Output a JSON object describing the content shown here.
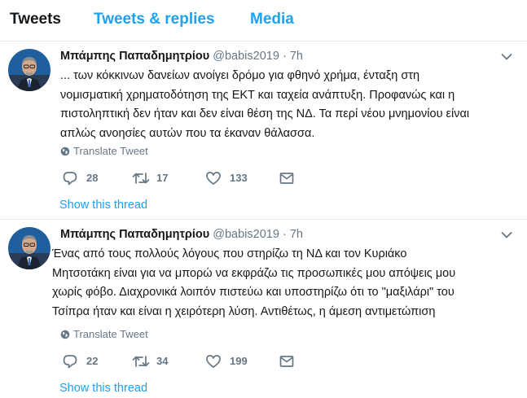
{
  "tabs": [
    {
      "label": "Tweets",
      "active": true
    },
    {
      "label": "Tweets & replies",
      "active": false
    },
    {
      "label": "Media",
      "active": false
    }
  ],
  "colors": {
    "accent": "#1da1f2",
    "secondary": "#657786",
    "text": "#14171a"
  },
  "tweets": [
    {
      "name": "Μπάμπης Παπαδημητρίου",
      "handle": "@babis2019",
      "separator": "·",
      "time": "7h",
      "lines": [
        "... των κόκκινων δανείων ανοίγει δρόμο για φθηνό χρήμα, ένταξη στη",
        "νομισματική χρηματοδότηση της ΕΚΤ και ταχεία ανάπτυξη. Προφανώς και η",
        "πιστοληπτική δεν ήταν και δεν είναι θέση της ΝΔ. Τα περί νέου μνημονίου είναι",
        "απλώς ανοησίες αυτών που τα έκαναν θάλασσα."
      ],
      "translate": "Translate Tweet",
      "replies": "28",
      "retweets": "17",
      "likes": "133",
      "show_thread": "Show this thread"
    },
    {
      "name": "Μπάμπης Παπαδημητρίου",
      "handle": "@babis2019",
      "separator": "·",
      "time": "7h",
      "lines": [
        "Ένας από τους πολλούς λόγους που στηρίζω τη ΝΔ και τον Κυριάκο",
        "Μητσοτάκη είναι για να μπορώ να εκφράζω τις προσωπικές μου απόψεις μου",
        "χωρίς φόβο. Διαχρονικά λοιπόν πιστεύω και υποστηρίζω ότι το \"μαξιλάρι\" του",
        "Τσίπρα ήταν και είναι η χειρότερη λύση. Αντιθέτως, η άμεση αντιμετώπιση"
      ],
      "translate": "Translate Tweet",
      "replies": "22",
      "retweets": "34",
      "likes": "199",
      "show_thread": "Show this thread"
    }
  ]
}
